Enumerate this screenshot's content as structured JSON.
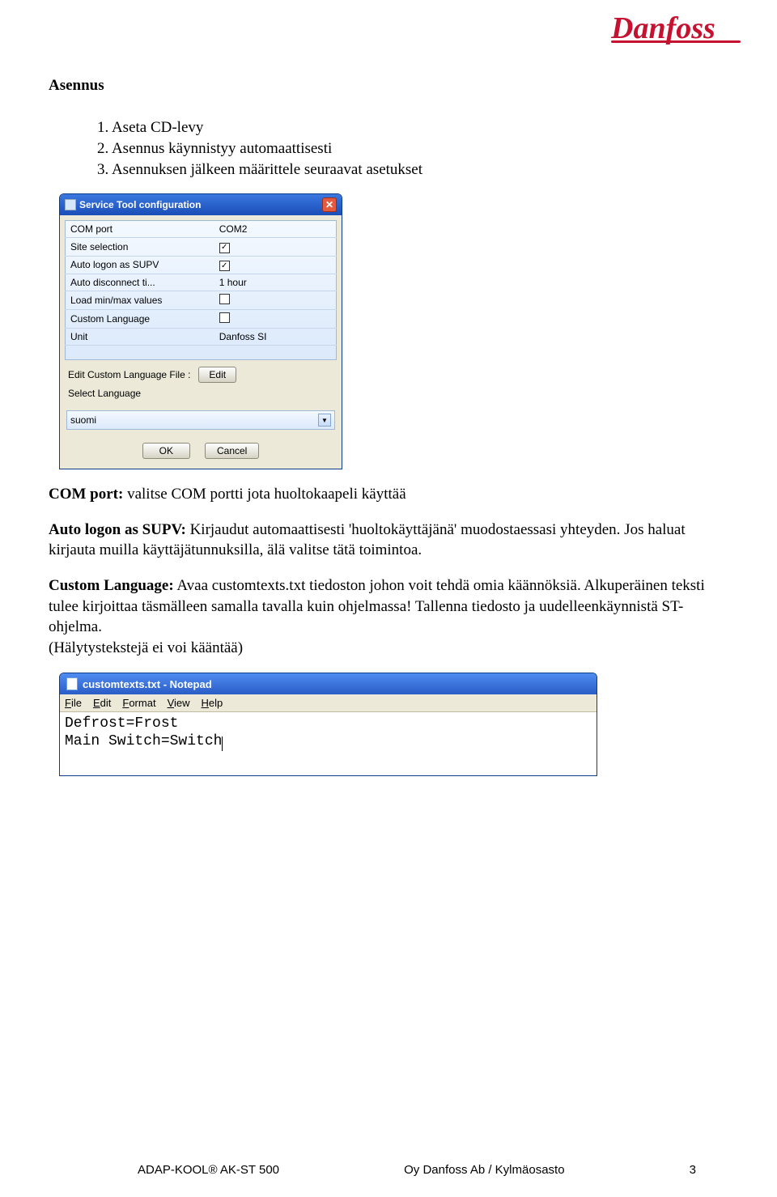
{
  "logo_text": "Danfoss",
  "title": "Asennus",
  "list_items": [
    "1.  Aseta CD-levy",
    "2.  Asennus käynnistyy automaattisesti",
    "3.  Asennuksen jälkeen määrittele seuraavat asetukset"
  ],
  "win": {
    "title": "Service Tool configuration",
    "rows": [
      {
        "label": "COM port",
        "value": "COM2",
        "checkbox": false,
        "checked": false
      },
      {
        "label": "Site selection",
        "value": "",
        "checkbox": true,
        "checked": true
      },
      {
        "label": "Auto logon as SUPV",
        "value": "",
        "checkbox": true,
        "checked": true
      },
      {
        "label": "Auto disconnect ti...",
        "value": "1 hour",
        "checkbox": false,
        "checked": false
      },
      {
        "label": "Load min/max values",
        "value": "",
        "checkbox": true,
        "checked": false
      },
      {
        "label": "Custom Language",
        "value": "",
        "checkbox": true,
        "checked": false
      },
      {
        "label": "Unit",
        "value": "Danfoss SI",
        "checkbox": false,
        "checked": false
      }
    ],
    "edit_label": "Edit Custom Language File :",
    "edit_btn": "Edit",
    "select_label": "Select Language",
    "combo_value": "suomi",
    "ok": "OK",
    "cancel": "Cancel"
  },
  "body": {
    "com_bold": "COM port:",
    "com_rest": " valitse COM portti jota huoltokaapeli käyttää",
    "supv_bold": "Auto logon as SUPV:",
    "supv_rest": " Kirjaudut automaattisesti 'huoltokäyttäjänä' muodostaessasi yhteyden. Jos haluat kirjauta muilla käyttäjätunnuksilla, älä valitse tätä toimintoa.",
    "cl_bold": "Custom Language:",
    "cl_rest": " Avaa customtexts.txt tiedoston johon voit tehdä omia käännöksiä. Alkuperäinen teksti tulee kirjoittaa täsmälleen samalla tavalla kuin ohjelmassa! Tallenna tiedosto ja uudelleenkäynnistä ST-ohjelma.",
    "alarm": "(Hälytystekstejä ei voi kääntää)"
  },
  "notepad": {
    "title": "customtexts.txt - Notepad",
    "menu": [
      "File",
      "Edit",
      "Format",
      "View",
      "Help"
    ],
    "line1": "Defrost=Frost",
    "line2": "Main Switch=Switch"
  },
  "footer": {
    "left": "ADAP-KOOL® AK-ST 500",
    "center": "Oy Danfoss Ab / Kylmäosasto",
    "page": "3"
  }
}
